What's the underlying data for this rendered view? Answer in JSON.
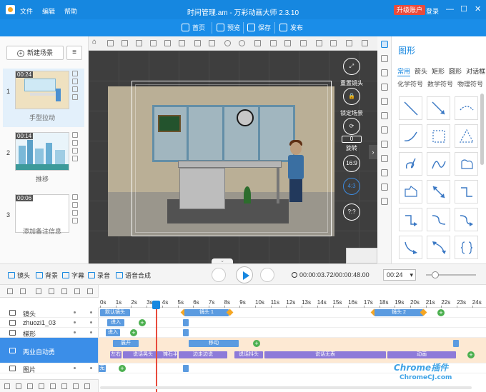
{
  "titlebar": {
    "menu": [
      "文件",
      "编辑",
      "帮助"
    ],
    "title": "时间管理.am - 万彩动画大师 2.3.10",
    "upgrade": "升级账户",
    "login": "登录",
    "min": "—",
    "max": "☐",
    "close": "✕"
  },
  "subbar": {
    "home": "首页",
    "preview": "预览",
    "save": "保存",
    "publish": "发布"
  },
  "scenes": {
    "new_scene": "新建场景",
    "items": [
      {
        "num": "1",
        "dur": "00:24",
        "name": "手型拉动"
      },
      {
        "num": "2",
        "dur": "00:14",
        "name": "推移"
      },
      {
        "num": "3",
        "dur": "00:06",
        "name": "添加备注信息"
      }
    ]
  },
  "canvas": {
    "tools": {
      "reset": "重置镜头",
      "lock": "锁定场景",
      "rotate": "旋转",
      "ratio169": "16:9",
      "ratio43": "4:3",
      "help": "?:?",
      "rotate_value": "0"
    }
  },
  "shapes_panel": {
    "title": "图形",
    "tabs": [
      "常用",
      "箭头",
      "矩形",
      "圆形",
      "对话框"
    ],
    "tabs2": [
      "化学符号",
      "数学符号",
      "物理符号"
    ]
  },
  "playbar": {
    "add_camera": "镜头",
    "add_bg": "背景",
    "add_subtitle": "字幕",
    "add_record": "录音",
    "add_tts": "语音合成",
    "timecode": "00:00:03.72/00:00:48.00",
    "zoom_value": "00:24"
  },
  "timeline": {
    "ticks": [
      "0s",
      "1s",
      "2s",
      "3s",
      "4s",
      "5s",
      "6s",
      "7s",
      "8s",
      "9s",
      "10s",
      "11s",
      "12s",
      "13s",
      "14s",
      "15s",
      "16s",
      "17s",
      "18s",
      "19s",
      "20s",
      "21s",
      "22s",
      "23s",
      "24s"
    ],
    "tracks": [
      {
        "name": "镜头"
      },
      {
        "name": "zhuozi1_03"
      },
      {
        "name": "梯形"
      },
      {
        "name": "两业自动勇"
      },
      {
        "name": "图片"
      }
    ],
    "seg_default_camera": "默认镜头",
    "seg_camera1": "镜头 1",
    "seg_camera2": "镜头 2",
    "seg_enter": "进入",
    "seg_enter2": "进入",
    "seg_expand": "展开",
    "seg_move": "移动",
    "seg_shake": "左右",
    "seg_a": "说话晃头",
    "seg_b": "摊石手",
    "seg_c": "边走边说",
    "seg_d": "说话抖头",
    "seg_e": "说话无表",
    "seg_f": "动画",
    "seg_none": "无"
  },
  "watermark": {
    "line1": "Chrome插件",
    "line2": "ChromeCJ.com"
  }
}
